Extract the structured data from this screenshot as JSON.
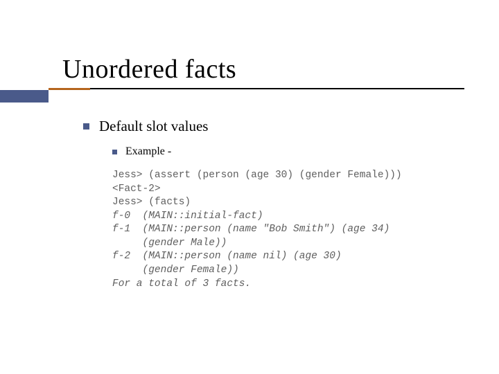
{
  "title": "Unordered facts",
  "level1": "Default slot values",
  "level2": "Example -",
  "code": {
    "l0": "Jess> (assert (person (age 30) (gender Female)))",
    "l1": "<Fact-2>",
    "l2": "Jess> (facts)",
    "l3": "f-0  (MAIN::initial-fact)",
    "l4": "f-1  (MAIN::person (name \"Bob Smith\") (age 34)",
    "l5": "     (gender Male))",
    "l6": "f-2  (MAIN::person (name nil) (age 30)",
    "l7": "     (gender Female))",
    "l8": "For a total of 3 facts."
  }
}
